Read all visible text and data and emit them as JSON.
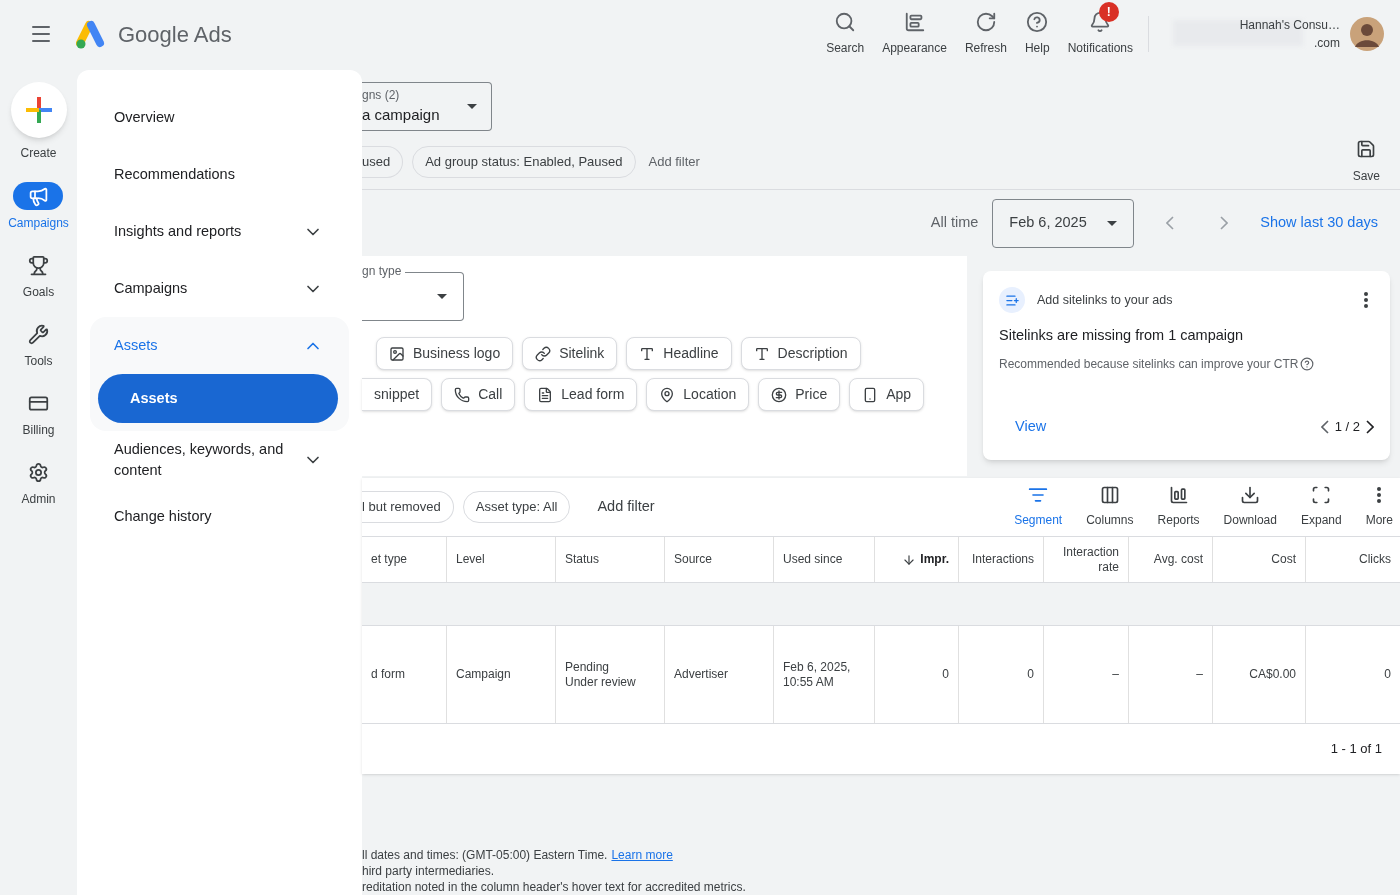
{
  "header": {
    "product": "Google Ads",
    "toolbar": [
      {
        "label": "Search"
      },
      {
        "label": "Appearance"
      },
      {
        "label": "Refresh"
      },
      {
        "label": "Help"
      },
      {
        "label": "Notifications",
        "badge": "!"
      }
    ],
    "account": {
      "name": "Hannah's Consu…",
      "email": ".com"
    }
  },
  "rail": [
    {
      "label": "Create",
      "kind": "fab",
      "selected": false
    },
    {
      "label": "Campaigns",
      "kind": "nav",
      "selected": true
    },
    {
      "label": "Goals",
      "kind": "nav",
      "selected": false
    },
    {
      "label": "Tools",
      "kind": "nav",
      "selected": false
    },
    {
      "label": "Billing",
      "kind": "nav",
      "selected": false
    },
    {
      "label": "Admin",
      "kind": "nav",
      "selected": false
    }
  ],
  "drawer": {
    "items": [
      {
        "label": "Overview",
        "kind": "link",
        "selected": false
      },
      {
        "label": "Recommendations",
        "kind": "link",
        "selected": false
      },
      {
        "label": "Insights and reports",
        "kind": "group",
        "expanded": false,
        "selected": false
      },
      {
        "label": "Campaigns",
        "kind": "group",
        "expanded": false,
        "selected": false
      },
      {
        "label": "Assets",
        "kind": "group",
        "expanded": true,
        "selected": true,
        "children": [
          {
            "label": "Assets",
            "selected": true
          }
        ]
      },
      {
        "label": "Audiences, keywords, and content",
        "kind": "group",
        "expanded": false,
        "selected": false
      },
      {
        "label": "Change history",
        "kind": "link",
        "selected": false
      }
    ]
  },
  "campaign_select": {
    "label": "gns (2)",
    "value": "a campaign"
  },
  "filters": {
    "chips": [
      {
        "label": "used",
        "kind": "partial"
      },
      {
        "label": "Ad group status: Enabled, Paused",
        "kind": "chip"
      }
    ],
    "add": "Add filter"
  },
  "save": "Save",
  "date_range": {
    "preset": "All time",
    "date": "Feb 6, 2025",
    "link": "Show last 30 days"
  },
  "asset_panel": {
    "type_select": {
      "label": "gn type"
    },
    "chip_rows": [
      [
        {
          "label": "Business logo",
          "kind": "chip"
        },
        {
          "label": "Sitelink",
          "kind": "chip"
        },
        {
          "label": "Headline",
          "kind": "chip"
        },
        {
          "label": "Description",
          "kind": "chip"
        }
      ],
      [
        {
          "label": "snippet",
          "kind": "partial"
        },
        {
          "label": "Call",
          "kind": "chip"
        },
        {
          "label": "Lead form",
          "kind": "chip"
        },
        {
          "label": "Location",
          "kind": "chip"
        },
        {
          "label": "Price",
          "kind": "chip"
        },
        {
          "label": "App",
          "kind": "chip"
        }
      ]
    ]
  },
  "recommendation": {
    "title": "Add sitelinks to your ads",
    "headline": "Sitelinks are missing from 1 campaign",
    "body": "Recommended because sitelinks can improve your CTR",
    "action": "View",
    "pager": "1 / 2"
  },
  "table": {
    "filters": [
      {
        "label": "l but removed",
        "kind": "partial"
      },
      {
        "label": "Asset type: All",
        "kind": "chip"
      }
    ],
    "add_filter": "Add filter",
    "toolbar": [
      {
        "label": "Segment",
        "selected": true
      },
      {
        "label": "Columns",
        "selected": false
      },
      {
        "label": "Reports",
        "selected": false
      },
      {
        "label": "Download",
        "selected": false
      },
      {
        "label": "Expand",
        "selected": false
      },
      {
        "label": "More",
        "selected": false
      }
    ],
    "columns": [
      {
        "label": "et type",
        "kind": "text",
        "sorted": false
      },
      {
        "label": "Level",
        "kind": "text",
        "sorted": false
      },
      {
        "label": "Status",
        "kind": "text",
        "sorted": false
      },
      {
        "label": "Source",
        "kind": "text",
        "sorted": false
      },
      {
        "label": "Used since",
        "kind": "text",
        "sorted": false
      },
      {
        "label": "Impr.",
        "kind": "metric",
        "sorted": true
      },
      {
        "label": "Interactions",
        "kind": "metric",
        "sorted": false
      },
      {
        "label": "Interaction rate",
        "kind": "metric",
        "sorted": false
      },
      {
        "label": "Avg. cost",
        "kind": "metric",
        "sorted": false
      },
      {
        "label": "Cost",
        "kind": "metric",
        "sorted": false
      },
      {
        "label": "Clicks",
        "kind": "metric",
        "sorted": false
      }
    ],
    "rows": [
      {
        "kind": "group"
      },
      {
        "kind": "data",
        "cells": [
          "d form",
          "Campaign",
          "Pending\nUnder review",
          "Advertiser",
          "Feb 6, 2025,\n10:55 AM",
          "0",
          "0",
          "–",
          "–",
          "CA$0.00",
          "0"
        ]
      }
    ],
    "pagination": "1 - 1 of 1"
  },
  "footer": [
    {
      "text": "ll dates and times: (GMT-05:00) Eastern Time.",
      "link": "Learn more"
    },
    {
      "text": "hird party intermediaries."
    },
    {
      "text": "reditation noted in the column header's hover text for accredited metrics."
    }
  ]
}
